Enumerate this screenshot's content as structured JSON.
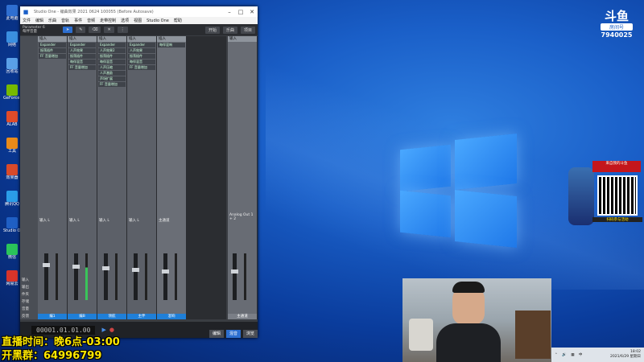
{
  "window": {
    "title": "Studio One - 编曲效果 2021 0624 100055 (Before Autosave)",
    "menus": [
      "文件",
      "编辑",
      "乐曲",
      "音轨",
      "事件",
      "音频",
      "走带控制",
      "选项",
      "视图",
      "Studio One",
      "帮助"
    ],
    "toolbar": {
      "track_name": "Parameter 6",
      "track_sub": "每伴音量",
      "btn_start": "开始",
      "btn_song": "乐曲",
      "btn_project": "项目"
    },
    "timecode": "00001.01.01.00",
    "bottom_buttons": [
      "编辑",
      "混音",
      "浏览"
    ]
  },
  "mixer": {
    "channels": [
      {
        "name": "编1",
        "color": "#1f7fd8",
        "inserts": [
          "Expander",
          "振荡插件",
          "FF 音量增加"
        ],
        "label": "输入 L"
      },
      {
        "name": "编B",
        "color": "#1f7fd8",
        "inserts": [
          "Expander",
          "人声效果",
          "振荡插件",
          "每伴混音",
          "FF 音量增加"
        ],
        "label": "输入 L"
      },
      {
        "name": "领航",
        "color": "#1f7fd8",
        "inserts": [
          "Expander",
          "人声效果2",
          "振荡插件",
          "每伴混音",
          "人声压缩",
          "人声激励",
          "声场扩展",
          "FF 音量增加"
        ],
        "label": "输入 L"
      },
      {
        "name": "主伴",
        "color": "#1f7fd8",
        "inserts": [
          "Expander",
          "人声效果",
          "振荡插件",
          "每伴混音",
          "FF 音量增加"
        ],
        "label": "输入 L"
      },
      {
        "name": "混响",
        "color": "#1f7fd8",
        "inserts": [
          "每伴混响"
        ],
        "label": "主通道"
      }
    ],
    "main_out": "Analog Out 1 + 2",
    "main_label": "主通道",
    "side_labels": [
      "输入",
      "输出",
      "件夹",
      "存储",
      "音量",
      "反馈"
    ]
  },
  "desktop_icons": [
    "此电脑",
    "网络",
    "回收站",
    "GeForce Experience",
    "ALAB",
    "工具",
    "效果器",
    "腾讯QQ",
    "Studio One",
    "微信",
    "网易云"
  ],
  "logo": {
    "brand": "斗鱼",
    "tag": "房间号",
    "room": "7940025"
  },
  "ad": {
    "line1": "来自我的斗鱼",
    "line2": "扫码参与活动"
  },
  "overlay_text": {
    "line1": "直播时间：晚6点-03:00",
    "line2": "开黑群：64996799"
  },
  "taskbar": {
    "time": "18:02",
    "date": "2021/6/29 星期日"
  }
}
